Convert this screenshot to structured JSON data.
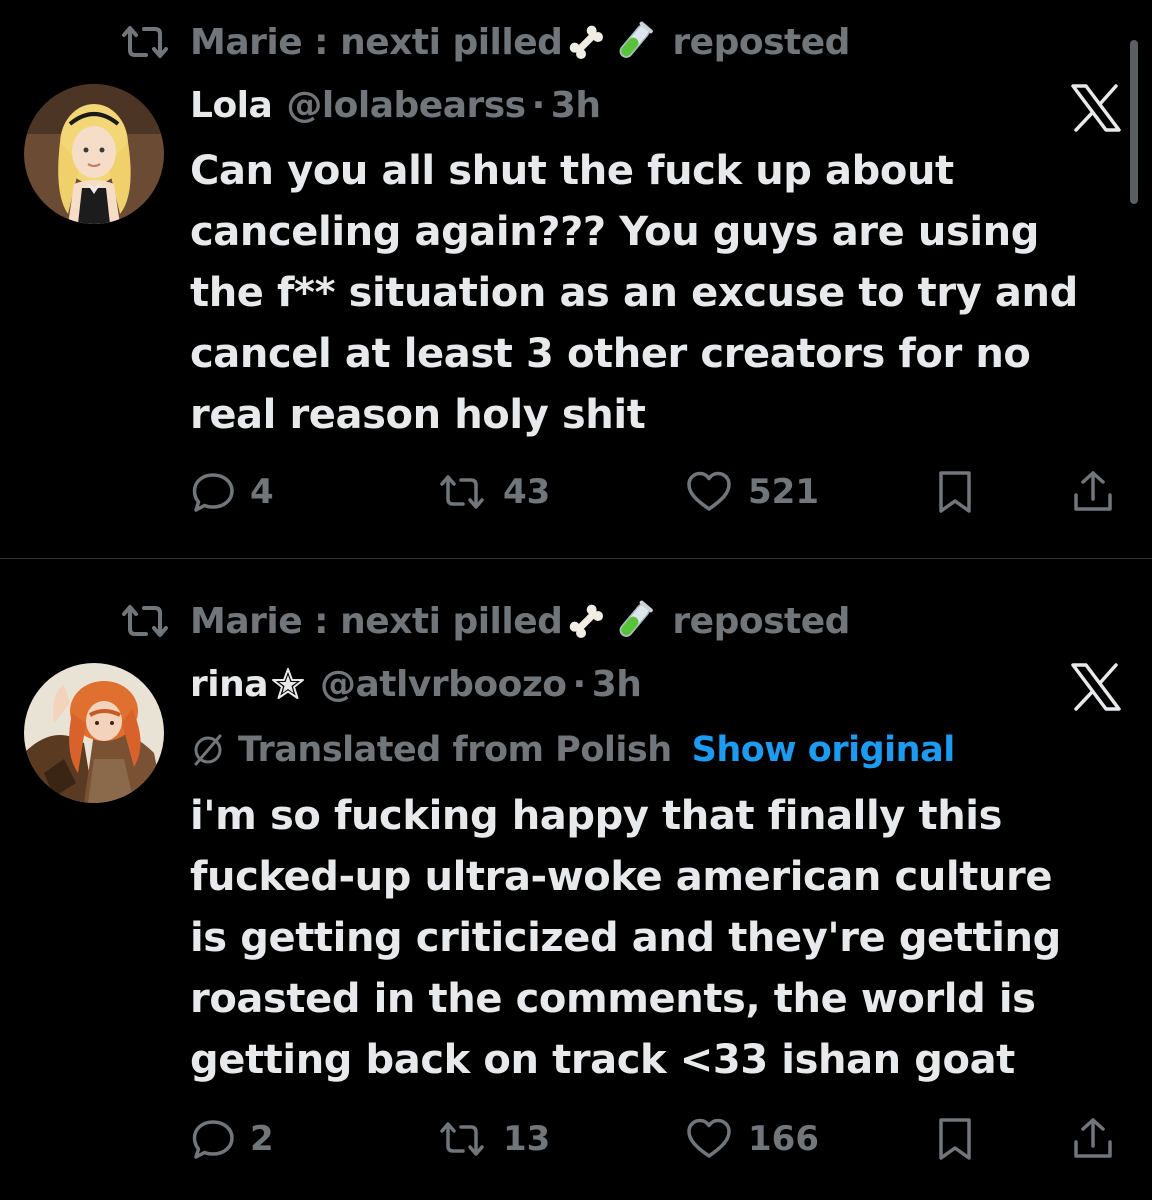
{
  "colors": {
    "background": "#000000",
    "primary_text": "#e7e9ea",
    "secondary_text": "#71767b",
    "link": "#1d9bf0",
    "divider": "#2f3336"
  },
  "tweets": [
    {
      "repost": {
        "user_name": "Marie : nexti pilled",
        "emojis": [
          "bone-emoji",
          "test-tube-emoji"
        ],
        "suffix": "reposted"
      },
      "author": {
        "display_name": "Lola",
        "handle": "@lolabearss",
        "separator": "·",
        "time": "3h"
      },
      "text": "Can you all shut the fuck up about\ncanceling again??? You guys are using\nthe f** situation as an excuse to try and\ncancel at least 3 other creators for no\nreal reason holy shit",
      "actions": {
        "replies": "4",
        "reposts": "43",
        "likes": "521"
      }
    },
    {
      "repost": {
        "user_name": "Marie : nexti pilled",
        "emojis": [
          "bone-emoji",
          "test-tube-emoji"
        ],
        "suffix": "reposted"
      },
      "author": {
        "display_name": "rina",
        "name_symbol": "star-icon",
        "handle": "@atlvrboozo",
        "separator": "·",
        "time": "3h"
      },
      "translation": {
        "label": "Translated from Polish",
        "link": "Show original"
      },
      "text": "i'm so fucking happy that finally this\nfucked-up ultra-woke american culture\nis getting criticized and they're getting\nroasted in the comments, the world is\ngetting back on track <33 ishan goat",
      "actions": {
        "replies": "2",
        "reposts": "13",
        "likes": "166"
      }
    }
  ]
}
